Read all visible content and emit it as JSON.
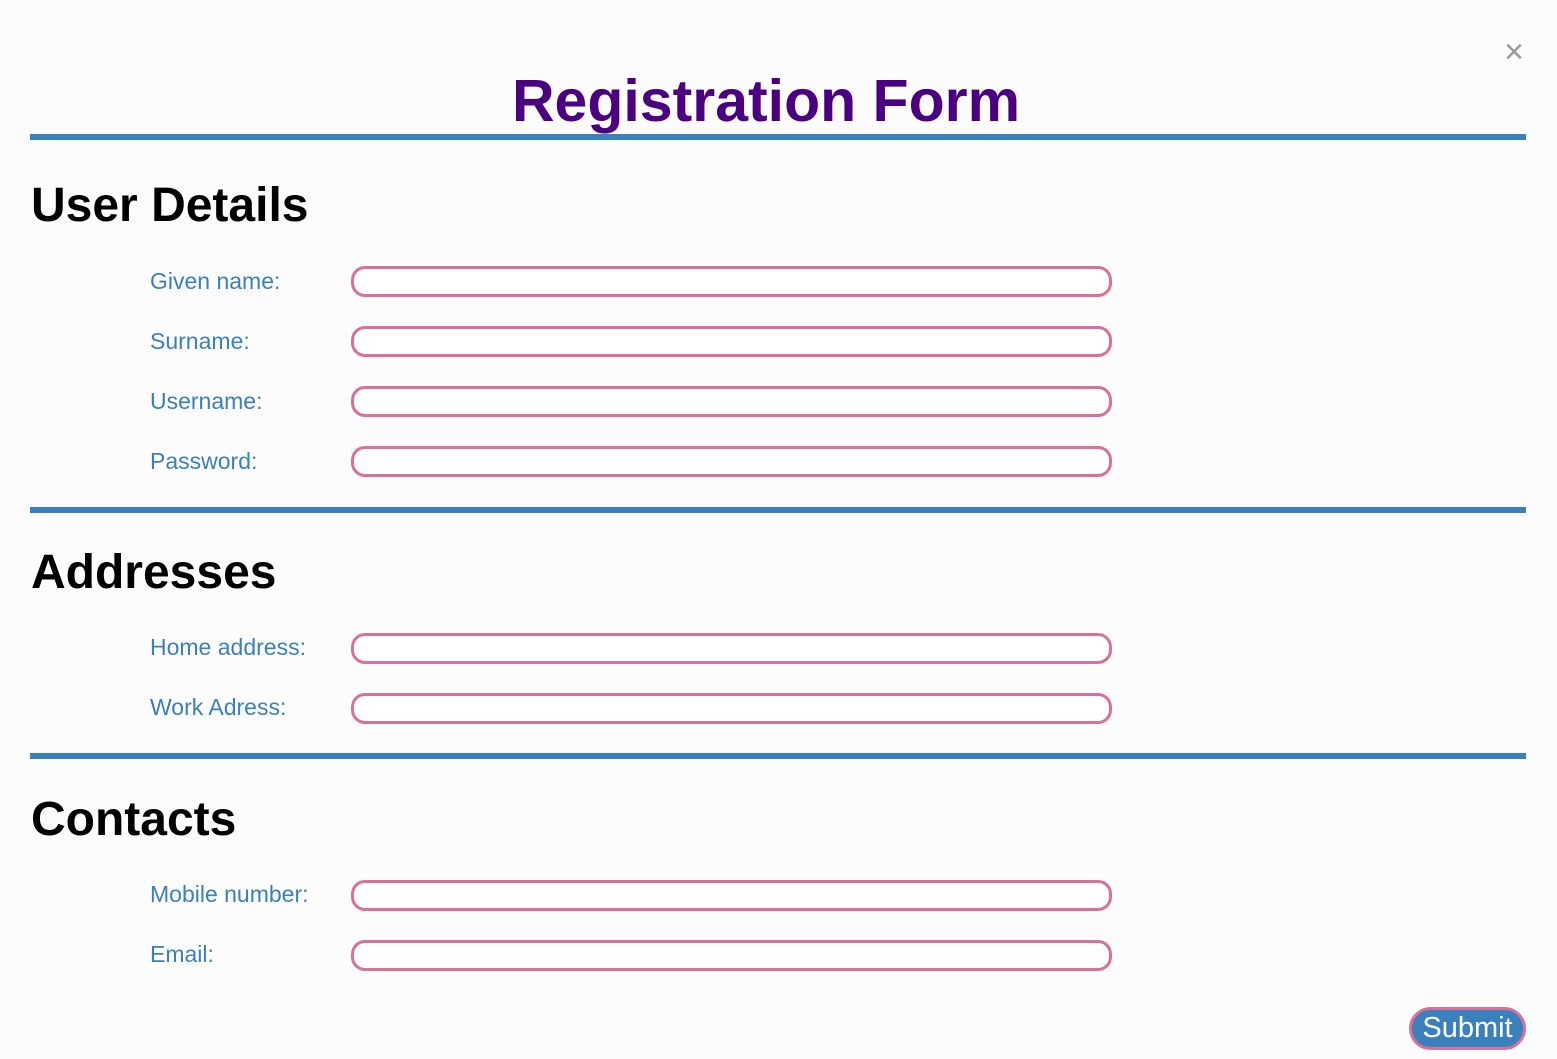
{
  "modal": {
    "close_symbol": "×",
    "title": "Registration Form",
    "submit_label": "Submit"
  },
  "colors": {
    "title": "#4b0082",
    "accent": "#3a80bd",
    "input_border": "#d9709a"
  },
  "icons": {
    "close": "close-icon"
  },
  "sections": [
    {
      "title": "User Details",
      "fields": [
        {
          "label": "Given name:",
          "value": "",
          "placeholder": ""
        },
        {
          "label": "Surname:",
          "value": "",
          "placeholder": ""
        },
        {
          "label": "Username:",
          "value": "",
          "placeholder": ""
        },
        {
          "label": "Password:",
          "value": "",
          "placeholder": ""
        }
      ]
    },
    {
      "title": "Addresses",
      "fields": [
        {
          "label": "Home address:",
          "value": "",
          "placeholder": ""
        },
        {
          "label": "Work Adress:",
          "value": "",
          "placeholder": ""
        }
      ]
    },
    {
      "title": "Contacts",
      "fields": [
        {
          "label": "Mobile number:",
          "value": "",
          "placeholder": ""
        },
        {
          "label": "Email:",
          "value": "",
          "placeholder": ""
        }
      ]
    }
  ]
}
